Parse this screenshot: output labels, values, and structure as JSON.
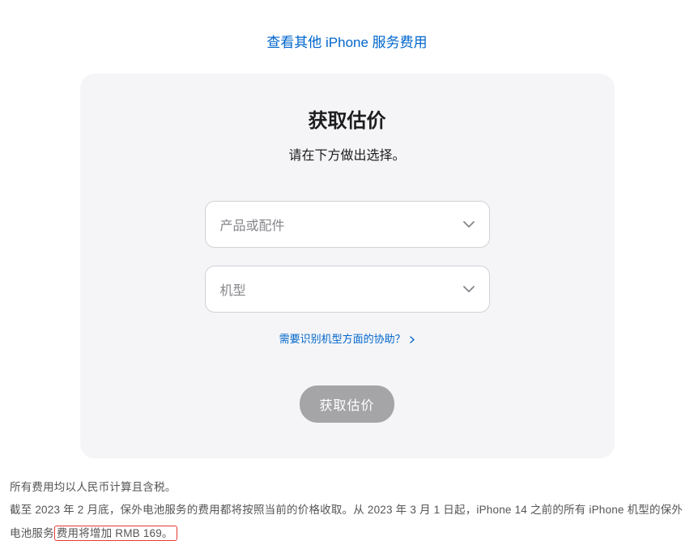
{
  "topLink": "查看其他 iPhone 服务费用",
  "card": {
    "title": "获取估价",
    "subtitle": "请在下方做出选择。",
    "select1": {
      "placeholder": "产品或配件"
    },
    "select2": {
      "placeholder": "机型"
    },
    "helpLink": "需要识别机型方面的协助？",
    "submit": "获取估价"
  },
  "footer": {
    "line1": "所有费用均以人民币计算且含税。",
    "line2_part1": "截至 2023 年 2 月底，保外电池服务的费用都将按照当前的价格收取。从 2023 年 3 月 1 日起，iPhone 14 之前的所有 iPhone 机型的保外电池服务",
    "line2_highlight": "费用将增加 RMB 169。"
  }
}
